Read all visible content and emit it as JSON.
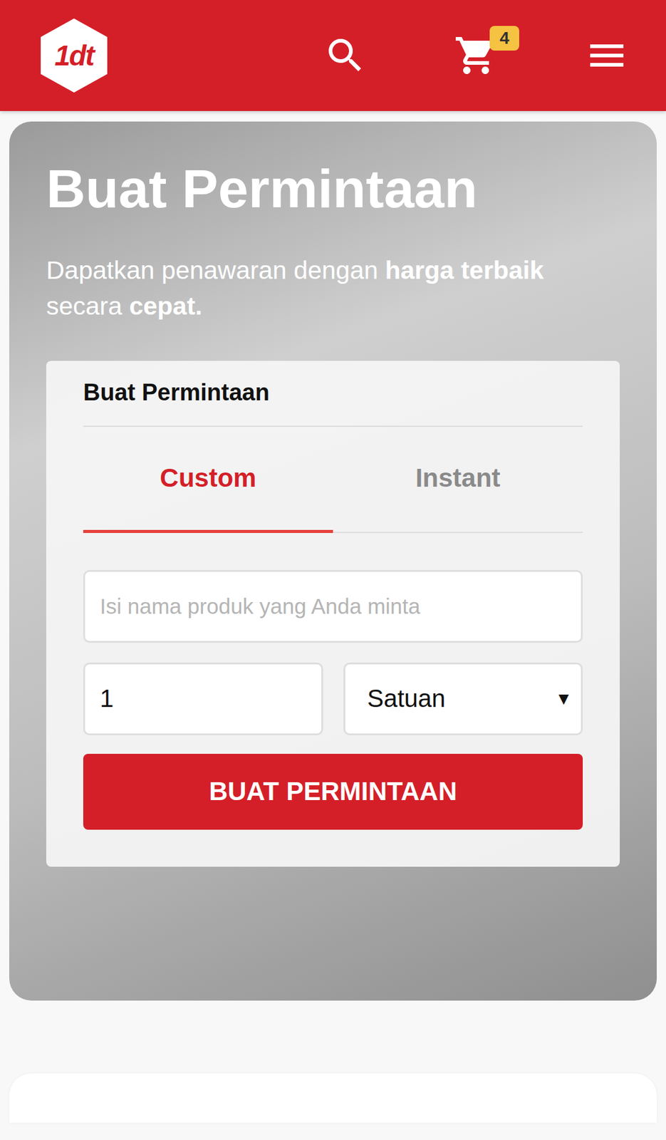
{
  "header": {
    "logo": "1dt",
    "cart_count": "4"
  },
  "hero": {
    "title": "Buat Permintaan",
    "subtitle": [
      {
        "text": "Dapatkan penawaran dengan ",
        "bold": false
      },
      {
        "text": "harga terbaik",
        "bold": true
      },
      {
        "text": " secara ",
        "bold": false
      },
      {
        "text": "cepat.",
        "bold": true
      }
    ]
  },
  "form": {
    "title": "Buat Permintaan",
    "tabs": [
      {
        "label": "Custom",
        "selected": true
      },
      {
        "label": "Instant",
        "selected": false
      }
    ],
    "product": {
      "placeholder": "Isi nama produk yang Anda minta"
    },
    "quantity": "1",
    "unit": {
      "value": "Satuan",
      "arrow": "▼"
    },
    "submit": "BUAT PERMINTAAN"
  }
}
